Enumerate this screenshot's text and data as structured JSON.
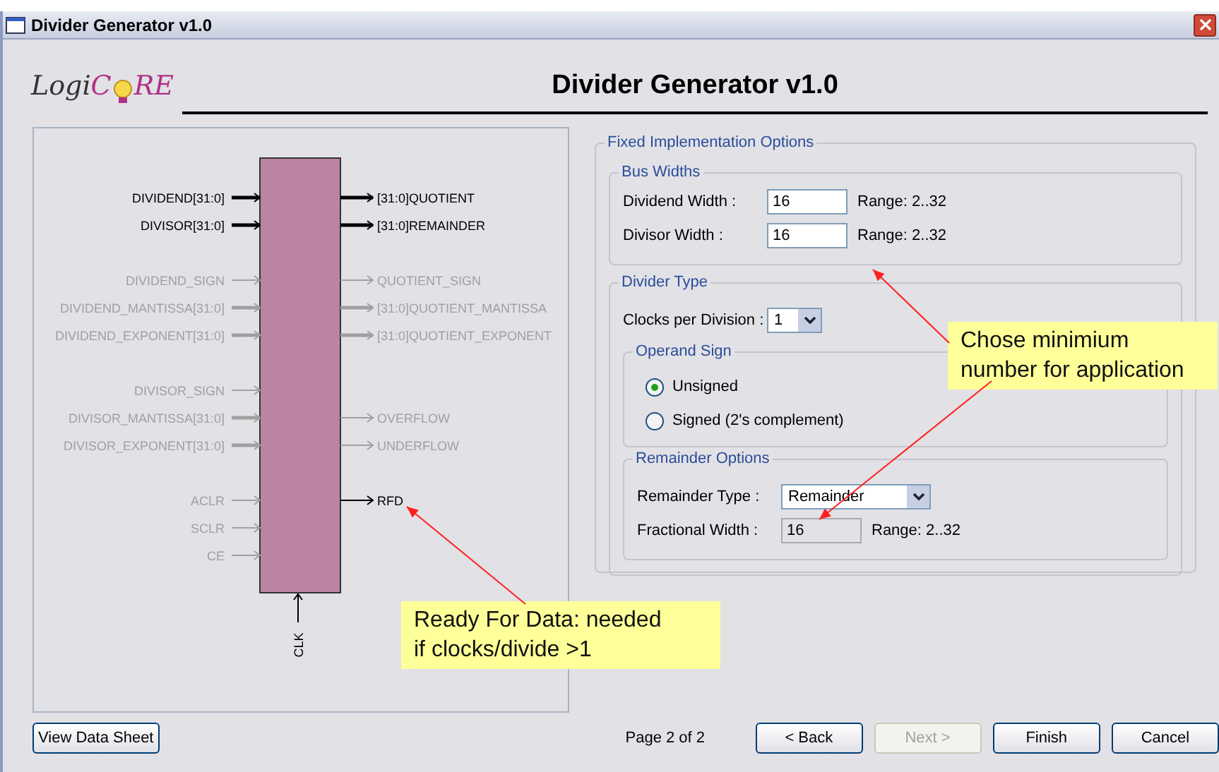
{
  "window": {
    "title": "Divider Generator v1.0"
  },
  "header": {
    "logo": {
      "part_1": "Logi",
      "part_2": "C",
      "part_3": "RE"
    },
    "title": "Divider Generator v1.0"
  },
  "diagram": {
    "pin_groups": [
      [
        {
          "left": {
            "label": "DIVIDEND[31:0]",
            "active": true,
            "bus": true
          },
          "right": {
            "label": "[31:0]QUOTIENT",
            "active": true,
            "bus": true
          }
        },
        {
          "left": {
            "label": "DIVISOR[31:0]",
            "active": true,
            "bus": true
          },
          "right": {
            "label": "[31:0]REMAINDER",
            "active": true,
            "bus": true
          }
        }
      ],
      [
        {
          "left": {
            "label": "DIVIDEND_SIGN",
            "active": false,
            "bus": false
          },
          "right": {
            "label": "QUOTIENT_SIGN",
            "active": false,
            "bus": false
          }
        },
        {
          "left": {
            "label": "DIVIDEND_MANTISSA[31:0]",
            "active": false,
            "bus": true
          },
          "right": {
            "label": "[31:0]QUOTIENT_MANTISSA",
            "active": false,
            "bus": true
          }
        },
        {
          "left": {
            "label": "DIVIDEND_EXPONENT[31:0]",
            "active": false,
            "bus": true
          },
          "right": {
            "label": "[31:0]QUOTIENT_EXPONENT",
            "active": false,
            "bus": true
          }
        }
      ],
      [
        {
          "left": {
            "label": "DIVISOR_SIGN",
            "active": false,
            "bus": false
          }
        },
        {
          "left": {
            "label": "DIVISOR_MANTISSA[31:0]",
            "active": false,
            "bus": true
          },
          "right": {
            "label": "OVERFLOW",
            "active": false,
            "bus": false
          }
        },
        {
          "left": {
            "label": "DIVISOR_EXPONENT[31:0]",
            "active": false,
            "bus": true
          },
          "right": {
            "label": "UNDERFLOW",
            "active": false,
            "bus": false
          }
        }
      ],
      [
        {
          "left": {
            "label": "ACLR",
            "active": false,
            "bus": false
          },
          "right": {
            "label": "RFD",
            "active": true,
            "bus": false
          }
        },
        {
          "left": {
            "label": "SCLR",
            "active": false,
            "bus": false
          }
        },
        {
          "left": {
            "label": "CE",
            "active": false,
            "bus": false
          }
        }
      ]
    ],
    "clock": {
      "label": "CLK",
      "active": true
    }
  },
  "options": {
    "title": "Fixed Implementation Options",
    "bus_widths": {
      "title": "Bus Widths",
      "fields": [
        {
          "label": "Dividend Width :",
          "value": "16",
          "range": "Range: 2..32"
        },
        {
          "label": "Divisor Width :",
          "value": "16",
          "range": "Range: 2..32"
        }
      ]
    },
    "divider_type": {
      "title": "Divider Type",
      "clocks": {
        "label": "Clocks per Division :",
        "value": "1"
      },
      "operand_sign": {
        "title": "Operand Sign",
        "options": [
          {
            "label": "Unsigned",
            "selected": true
          },
          {
            "label": "Signed (2's complement)",
            "selected": false
          }
        ]
      },
      "remainder_options": {
        "title": "Remainder Options",
        "type": {
          "label": "Remainder Type :",
          "value": "Remainder"
        },
        "fractional_width": {
          "label": "Fractional Width :",
          "value": "16",
          "range": "Range: 2..32",
          "disabled": true
        }
      }
    }
  },
  "footer": {
    "datasheet_button": "View Data Sheet",
    "page": "Page 2 of 2",
    "buttons": [
      {
        "label": "< Back",
        "disabled": false
      },
      {
        "label": "Next >",
        "disabled": true
      },
      {
        "label": "Finish",
        "disabled": false
      },
      {
        "label": "Cancel",
        "disabled": false
      }
    ]
  },
  "annotations": [
    {
      "text": "Chose minimium\nnumber for application"
    },
    {
      "text": "Ready For Data: needed\nif clocks/divide >1"
    }
  ]
}
